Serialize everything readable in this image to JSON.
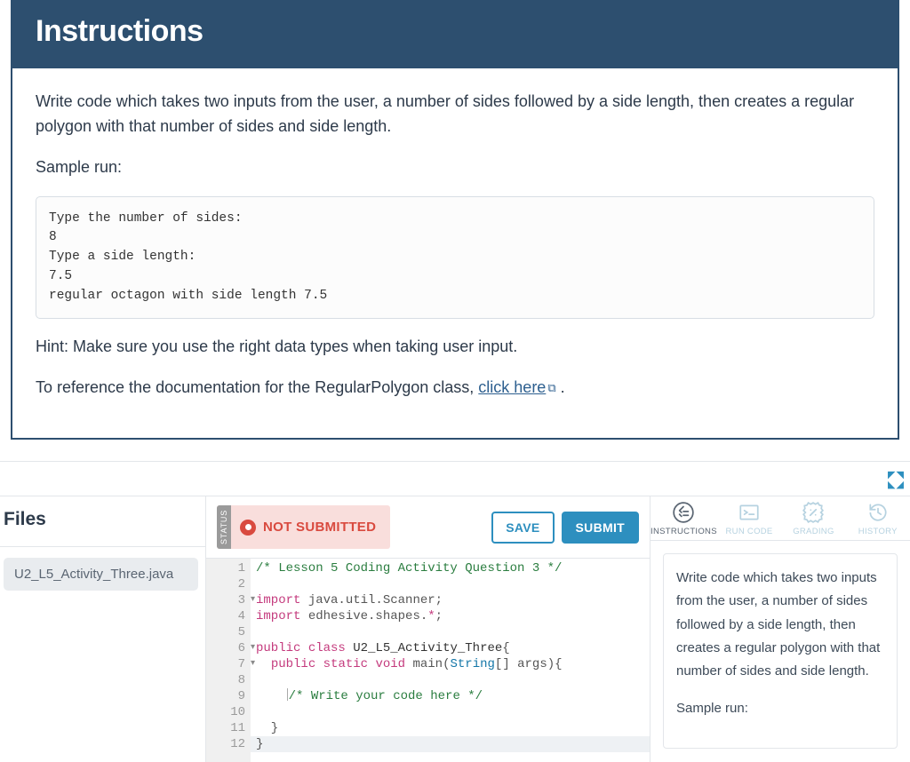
{
  "instructions": {
    "title": "Instructions",
    "para1": "Write code which takes two inputs from the user, a number of sides followed by a side length, then creates a regular polygon with that number of sides and side length.",
    "sample_label": "Sample run:",
    "sample_text": "Type the number of sides:\n8\nType a side length:\n7.5\nregular octagon with side length 7.5",
    "hint": "Hint: Make sure you use the right data types when taking user input.",
    "ref_prefix": "To reference the documentation for the RegularPolygon class, ",
    "ref_link": "click here",
    "ref_suffix": " ."
  },
  "files": {
    "title": "Files",
    "items": [
      "U2_L5_Activity_Three.java"
    ]
  },
  "editor": {
    "status_label": "STATUS",
    "status_text": "NOT SUBMITTED",
    "save": "SAVE",
    "submit": "SUBMIT",
    "lines": [
      {
        "n": 1,
        "raw": "/* Lesson 5 Coding Activity Question 3 */",
        "cls": "kw1"
      },
      {
        "n": 2,
        "raw": "",
        "cls": ""
      },
      {
        "n": 3,
        "fold": true,
        "segments": [
          [
            "kw2",
            "import"
          ],
          [
            "pun",
            " java.util.Scanner;"
          ]
        ]
      },
      {
        "n": 4,
        "segments": [
          [
            "kw2",
            "import"
          ],
          [
            "pun",
            " edhesive.shapes."
          ],
          [
            "ast",
            "*"
          ],
          [
            "pun",
            ";"
          ]
        ]
      },
      {
        "n": 5,
        "raw": "",
        "cls": ""
      },
      {
        "n": 6,
        "fold": true,
        "segments": [
          [
            "kw2",
            "public"
          ],
          [
            "pun",
            " "
          ],
          [
            "kw2",
            "class"
          ],
          [
            "pun",
            " "
          ],
          [
            "cls",
            "U2_L5_Activity_Three"
          ],
          [
            "pun",
            "{"
          ]
        ]
      },
      {
        "n": 7,
        "fold": true,
        "segments": [
          [
            "pun",
            "  "
          ],
          [
            "kw2",
            "public"
          ],
          [
            "pun",
            " "
          ],
          [
            "kw2",
            "static"
          ],
          [
            "pun",
            " "
          ],
          [
            "kw2",
            "void"
          ],
          [
            "pun",
            " main("
          ],
          [
            "typ",
            "String"
          ],
          [
            "pun",
            "[] args){"
          ]
        ]
      },
      {
        "n": 8,
        "raw": "",
        "cls": ""
      },
      {
        "n": 9,
        "segments": [
          [
            "pun",
            "    "
          ],
          [
            "cursor",
            ""
          ],
          [
            "kw1",
            "/* Write your code here */"
          ]
        ]
      },
      {
        "n": 10,
        "raw": "",
        "cls": ""
      },
      {
        "n": 11,
        "raw": "  }",
        "cls": "pun"
      },
      {
        "n": 12,
        "hl": true,
        "raw": "}",
        "cls": "pun"
      }
    ]
  },
  "tabs": {
    "instructions": "INSTRUCTIONS",
    "runcode": "RUN CODE",
    "grading": "GRADING",
    "history": "HISTORY"
  },
  "right_panel": {
    "para": "Write code which takes two inputs from the user, a number of sides followed by a side length, then creates a regular polygon with that number of sides and side length.",
    "sample_label": "Sample run:"
  }
}
